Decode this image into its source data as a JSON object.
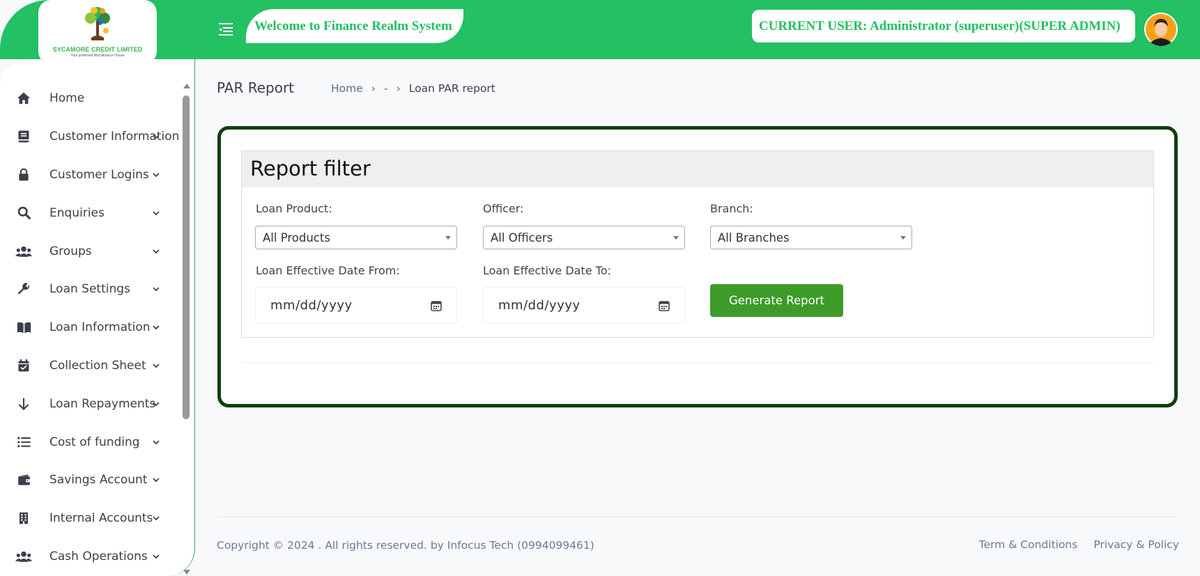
{
  "header": {
    "logo_name": "SYCAMORE CREDIT LIMITED",
    "logo_tagline": "Your preferred Microfinance House",
    "welcome_text": "Welcome to Finance Realm System",
    "current_user_text": "CURRENT USER: Administrator (superuser)(SUPER ADMIN)"
  },
  "sidebar": {
    "items": [
      {
        "label": "Home",
        "icon": "home-icon",
        "has_submenu": false
      },
      {
        "label": "Customer Information",
        "icon": "book-icon",
        "has_submenu": true
      },
      {
        "label": "Customer Logins",
        "icon": "lock-icon",
        "has_submenu": true
      },
      {
        "label": "Enquiries",
        "icon": "search-icon",
        "has_submenu": true
      },
      {
        "label": "Groups",
        "icon": "users-icon",
        "has_submenu": true
      },
      {
        "label": "Loan Settings",
        "icon": "wrench-icon",
        "has_submenu": true
      },
      {
        "label": "Loan Information",
        "icon": "open-book-icon",
        "has_submenu": true
      },
      {
        "label": "Collection Sheet",
        "icon": "calendar-check-icon",
        "has_submenu": true
      },
      {
        "label": "Loan Repayments",
        "icon": "arrow-down-icon",
        "has_submenu": true
      },
      {
        "label": "Cost of funding",
        "icon": "list-icon",
        "has_submenu": true
      },
      {
        "label": "Savings Account",
        "icon": "wallet-icon",
        "has_submenu": true
      },
      {
        "label": "Internal Accounts",
        "icon": "building-icon",
        "has_submenu": true
      },
      {
        "label": "Cash Operations",
        "icon": "users-icon",
        "has_submenu": true
      }
    ]
  },
  "page": {
    "title": "PAR Report",
    "breadcrumb": {
      "home": "Home",
      "middle": "-",
      "current": "Loan PAR report"
    }
  },
  "filter": {
    "title": "Report filter",
    "loan_product_label": "Loan Product:",
    "loan_product_value": "All Products",
    "officer_label": "Officer:",
    "officer_value": "All Officers",
    "branch_label": "Branch:",
    "branch_value": "All Branches",
    "date_from_label": "Loan Effective Date From:",
    "date_from_placeholder": "mm/dd/yyyy",
    "date_to_label": "Loan Effective Date To:",
    "date_to_placeholder": "mm/dd/yyyy",
    "generate_label": "Generate Report"
  },
  "footer": {
    "copyright": "Copyright © 2024 . All rights reserved. by Infocus Tech (0994099461)",
    "terms": "Term & Conditions",
    "privacy": "Privacy & Policy"
  },
  "colors": {
    "brand_green": "#23c064",
    "button_green": "#3d9b28",
    "card_border": "#143d0f"
  }
}
